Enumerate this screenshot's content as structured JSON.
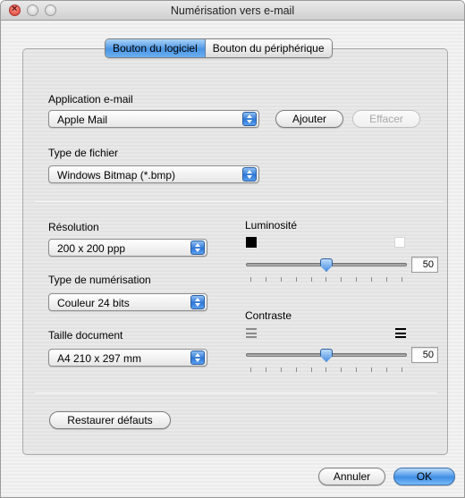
{
  "window": {
    "title": "Numérisation vers e-mail"
  },
  "tabs": [
    {
      "label": "Bouton du logiciel",
      "selected": true
    },
    {
      "label": "Bouton du périphérique",
      "selected": false
    }
  ],
  "email_app": {
    "label": "Application e-mail",
    "value": "Apple Mail",
    "add_button": "Ajouter",
    "delete_button": "Effacer",
    "delete_enabled": false
  },
  "file_type": {
    "label": "Type de fichier",
    "value": "Windows Bitmap (*.bmp)"
  },
  "resolution": {
    "label": "Résolution",
    "value": "200 x 200 ppp"
  },
  "scan_type": {
    "label": "Type de numérisation",
    "value": "Couleur 24 bits"
  },
  "document_size": {
    "label": "Taille document",
    "value": "A4 210 x 297 mm"
  },
  "brightness": {
    "label": "Luminosité",
    "value": "50",
    "level": 0.5,
    "min_icon": "black-square-icon",
    "max_icon": "white-square-icon"
  },
  "contrast": {
    "label": "Contraste",
    "value": "50",
    "level": 0.5,
    "min_icon": "low-contrast-lines-icon",
    "max_icon": "high-contrast-lines-icon"
  },
  "restore_button": "Restaurer défauts",
  "footer": {
    "cancel_button": "Annuler",
    "ok_button": "OK"
  },
  "colors": {
    "accent": "#4a95e4",
    "window_bg": "#ececec"
  }
}
